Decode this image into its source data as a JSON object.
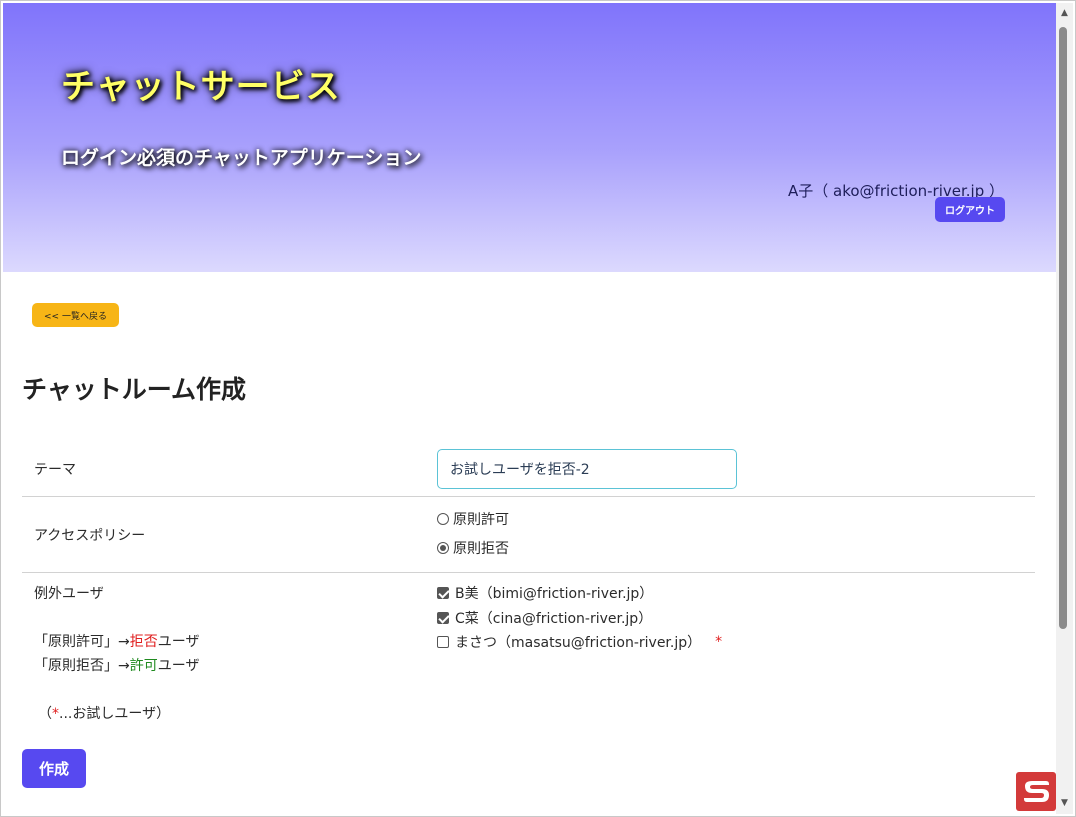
{
  "header": {
    "title": "チャットサービス",
    "subtitle": "ログイン必須のチャットアプリケーション",
    "user_info": "A子（ ako@friction-river.jp ）",
    "logout_label": "ログアウト"
  },
  "nav": {
    "back_label": "<< 一覧へ戻る"
  },
  "page": {
    "title": "チャットルーム作成"
  },
  "form": {
    "theme": {
      "label": "テーマ",
      "value": "お試しユーザを拒否-2"
    },
    "policy": {
      "label": "アクセスポリシー",
      "options": [
        {
          "label": "原則許可",
          "checked": false
        },
        {
          "label": "原則拒否",
          "checked": true
        }
      ]
    },
    "exceptions": {
      "label": "例外ユーザ",
      "note1_prefix": "「原則許可」→",
      "note1_highlight": "拒否",
      "note1_suffix": "ユーザ",
      "note2_prefix": "「原則拒否」→",
      "note2_highlight": "許可",
      "note2_suffix": "ユーザ",
      "legend_open": "（",
      "legend_mark": "*",
      "legend_text": "...お試しユーザ）",
      "users": [
        {
          "label": "B美（bimi@friction-river.jp）",
          "checked": true,
          "trial": ""
        },
        {
          "label": "C菜（cina@friction-river.jp）",
          "checked": true,
          "trial": ""
        },
        {
          "label": "まさつ（masatsu@friction-river.jp）",
          "checked": false,
          "trial": "*"
        }
      ]
    },
    "submit_label": "作成"
  },
  "colors": {
    "accent": "#5749f0",
    "back_button": "#f7b516",
    "header_top": "#8074fb",
    "header_bottom": "#dcd9fe",
    "title_text": "#ffff66"
  },
  "icons": {
    "scroll_up": "▲",
    "scroll_down": "▼"
  }
}
